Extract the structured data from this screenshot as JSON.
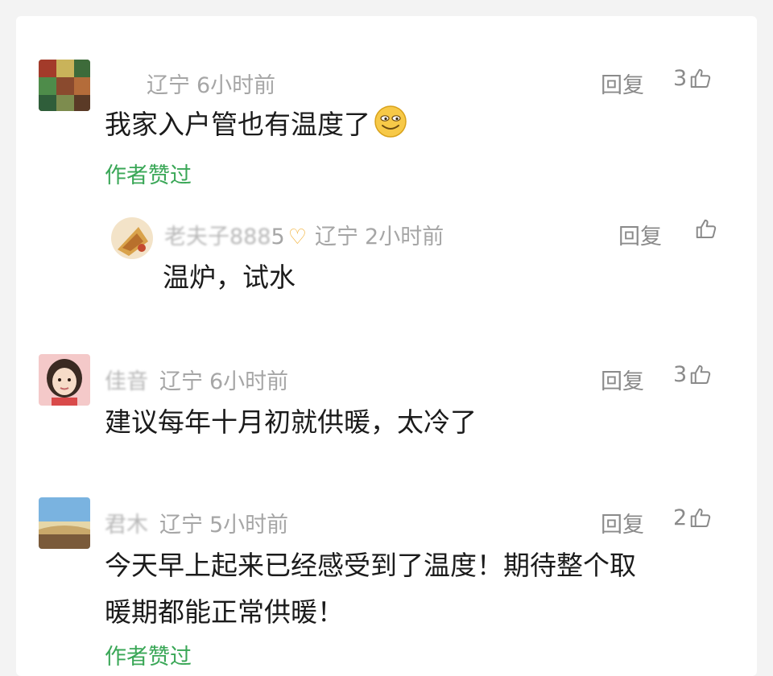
{
  "comments": [
    {
      "location": "辽宁",
      "time": "6小时前",
      "reply_label": "回复",
      "likes": "3",
      "text": "我家入户管也有温度了",
      "emoji": "grinning-face-emoji",
      "author_liked": "作者赞过",
      "replies": [
        {
          "name_suffix": "5",
          "location": "辽宁",
          "time": "2小时前",
          "reply_label": "回复",
          "text": "温炉，试水"
        }
      ]
    },
    {
      "location": "辽宁",
      "time": "6小时前",
      "reply_label": "回复",
      "likes": "3",
      "text": "建议每年十月初就供暖，太冷了"
    },
    {
      "location": "辽宁",
      "time": "5小时前",
      "reply_label": "回复",
      "likes": "2",
      "text_line1": "今天早上起来已经感受到了温度！期待整个取",
      "text_line2": "暖期都能正常供暖！",
      "author_liked": "作者赞过"
    }
  ],
  "colors": {
    "author_liked": "#3aa757",
    "meta": "#a6a6a6",
    "text": "#1b1b1b"
  }
}
